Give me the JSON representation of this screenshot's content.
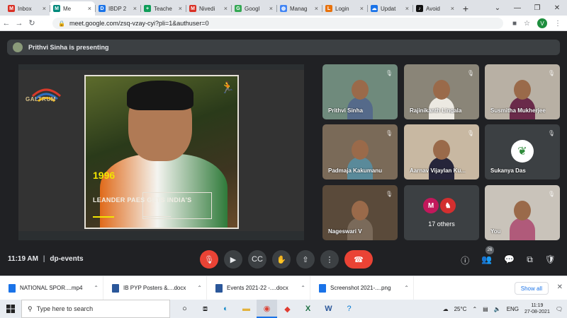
{
  "browser": {
    "tabs": [
      {
        "label": "Inbox",
        "icon": "gmail-icon",
        "color": "#d93025",
        "letter": "M"
      },
      {
        "label": "Me",
        "icon": "meet-icon",
        "color": "#00897b",
        "letter": "M",
        "active": true
      },
      {
        "label": "IBDP 2",
        "icon": "drive-icon",
        "color": "#1a73e8",
        "letter": "D"
      },
      {
        "label": "Teache",
        "icon": "classroom-icon",
        "color": "#0f9d58",
        "letter": "+"
      },
      {
        "label": "Nivedi",
        "icon": "gmail-icon",
        "color": "#d93025",
        "letter": "M"
      },
      {
        "label": "Googl",
        "icon": "google-icon",
        "color": "#34a853",
        "letter": "G"
      },
      {
        "label": "Manag",
        "icon": "globe-icon",
        "color": "#4285f4",
        "letter": "◍"
      },
      {
        "label": "Login",
        "icon": "login-icon",
        "color": "#e8710a",
        "letter": "L"
      },
      {
        "label": "Updat",
        "icon": "cloud-icon",
        "color": "#1a73e8",
        "letter": "☁"
      },
      {
        "label": "Avoid",
        "icon": "tiktok-icon",
        "color": "#111111",
        "letter": "♪"
      }
    ],
    "url": "meet.google.com/zsq-vzay-cyi?pli=1&authuser=0",
    "profile_letter": "V"
  },
  "meet": {
    "presenting_text": "Prithvi Sinha is presenting",
    "slide": {
      "logo_text": "GALTRUM",
      "year": "1996",
      "caption": "LEANDER PAES GETS INDIA'S"
    },
    "participants": [
      {
        "name": "Prithvi Sinha",
        "bg": "#6f8a7c",
        "shirt": "#556a8a"
      },
      {
        "name": "Rajinikanth Lingala",
        "bg": "#8a8578",
        "shirt": "#ece9e2"
      },
      {
        "name": "Susmitha Mukherjee",
        "bg": "#b8b0a4",
        "shirt": "#6a2a4a"
      },
      {
        "name": "Padmaja Kakumanu",
        "bg": "#7a6a58",
        "shirt": "#5a8a9a"
      },
      {
        "name": "Aarnav Vijaylan Ku...",
        "bg": "#c8b8a2",
        "shirt": "#26253a"
      },
      {
        "name": "Sukanya Das",
        "bg": "#3c4043",
        "avatar": true
      },
      {
        "name": "Nageswari V",
        "bg": "#5a4a3a",
        "shirt": "#7a6a5a"
      },
      {
        "name": "17 others",
        "bg": "#3c4043",
        "others": true,
        "initial": "M"
      },
      {
        "name": "You",
        "bg": "#c9c3ba",
        "shirt": "#b05a7a"
      }
    ],
    "time": "11:19 AM",
    "separator": "|",
    "meeting_name": "dp-events",
    "people_count": "26"
  },
  "downloads": [
    {
      "name": "NATIONAL SPOR....mp4",
      "color": "#1a73e8"
    },
    {
      "name": "IB PYP Posters &....docx",
      "color": "#2b579a"
    },
    {
      "name": "Events 2021-22 -....docx",
      "color": "#2b579a"
    },
    {
      "name": "Screenshot 2021-....png",
      "color": "#1a73e8"
    }
  ],
  "show_all": "Show all",
  "taskbar": {
    "search_placeholder": "Type here to search",
    "temperature": "25°C",
    "language": "ENG",
    "time": "11:19",
    "date": "27-08-2021"
  }
}
